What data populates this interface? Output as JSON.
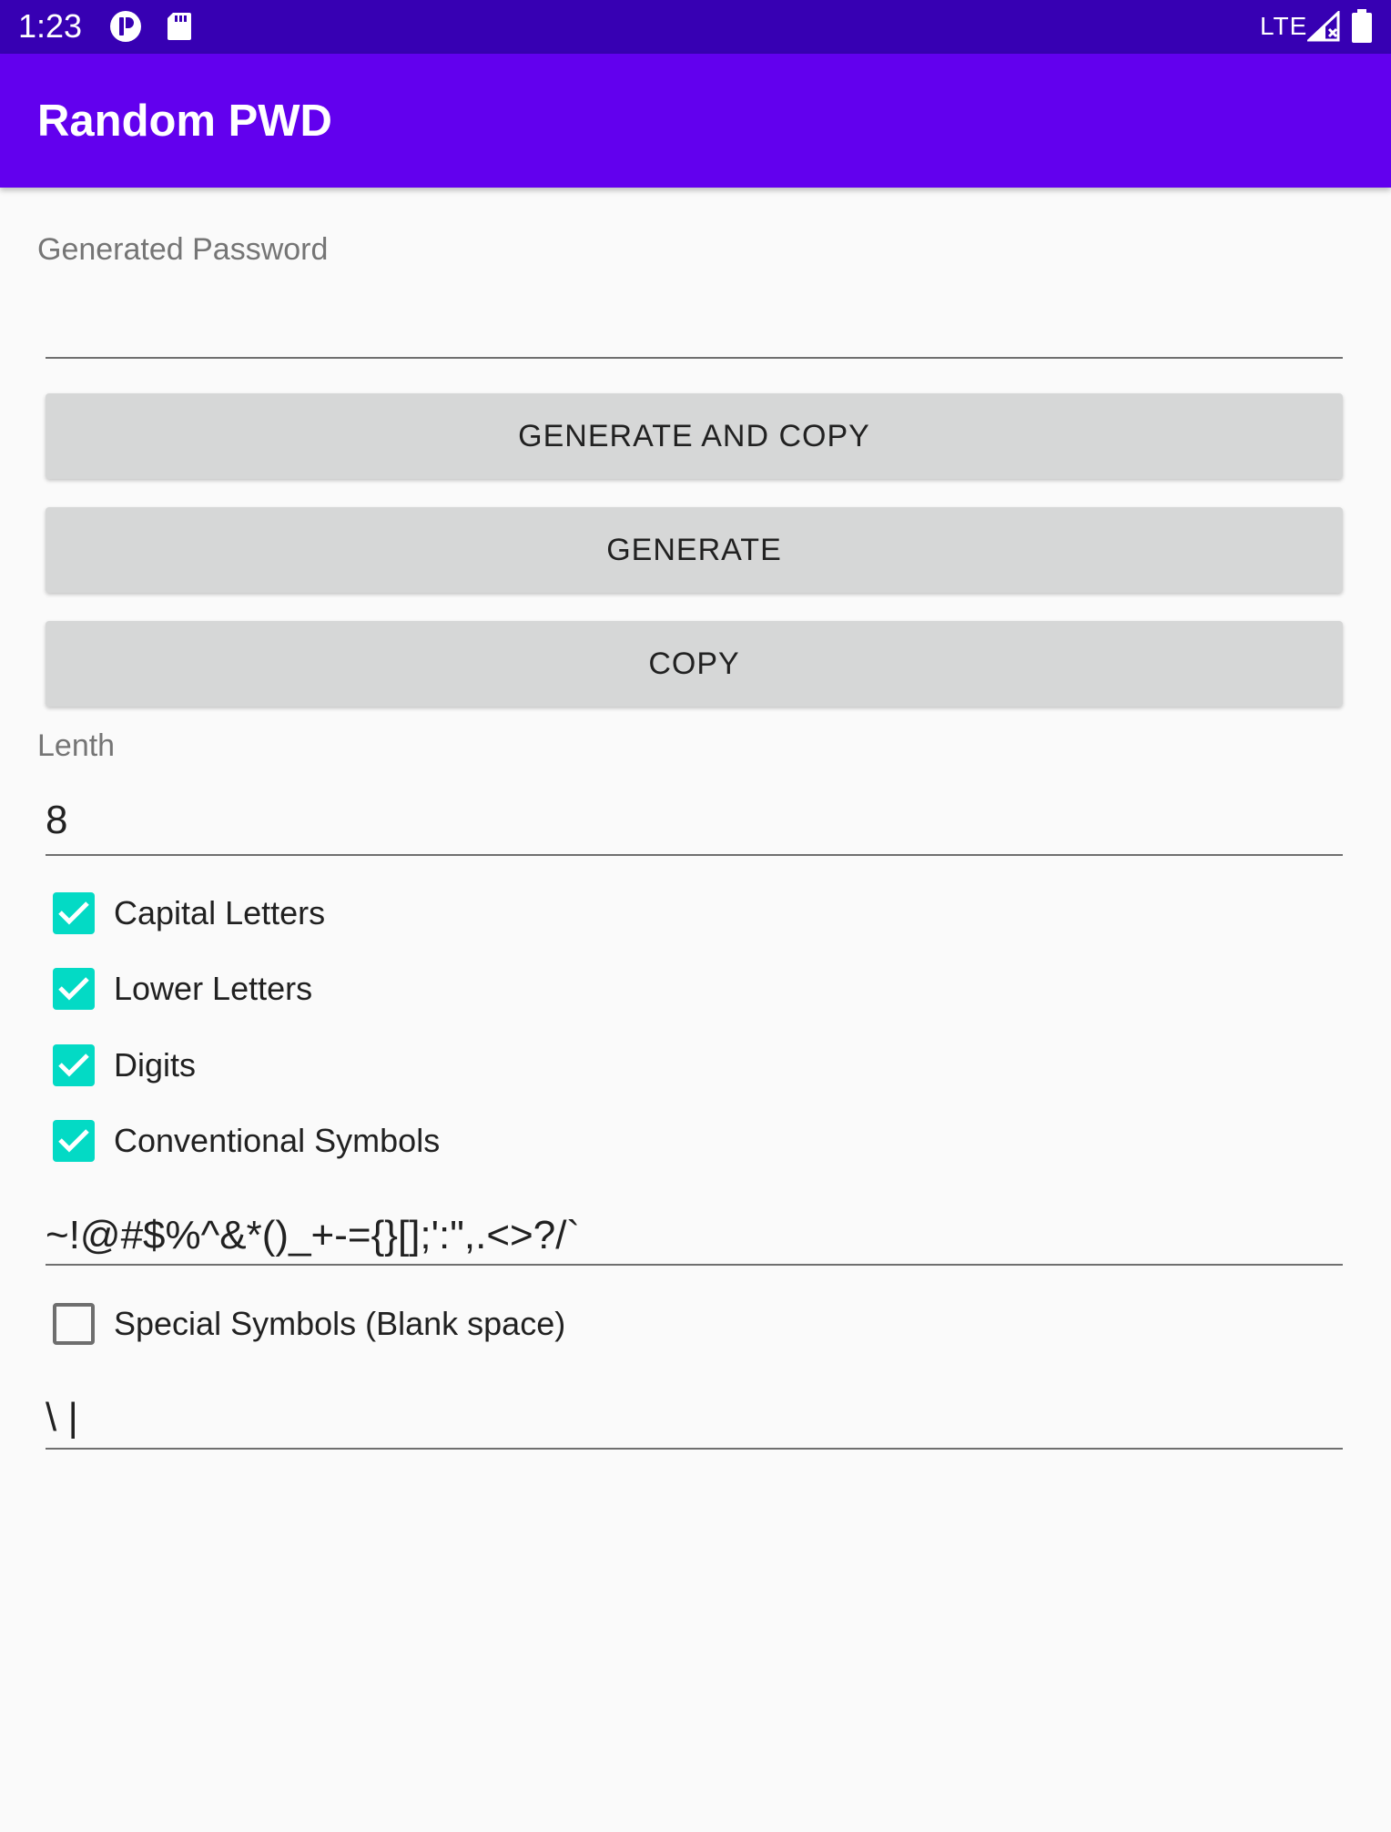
{
  "status_bar": {
    "time": "1:23",
    "network": "LTE",
    "icons": [
      "app-notification-icon",
      "sd-card-icon",
      "signal-icon",
      "battery-icon"
    ]
  },
  "app_bar": {
    "title": "Random PWD",
    "color": "#6200ee"
  },
  "password_field": {
    "label": "Generated Password",
    "value": ""
  },
  "buttons": {
    "generate_and_copy": "GENERATE AND COPY",
    "generate": "GENERATE",
    "copy": "COPY"
  },
  "length_field": {
    "label": "Lenth",
    "value": "8"
  },
  "options": [
    {
      "label": "Capital Letters",
      "checked": true
    },
    {
      "label": "Lower Letters",
      "checked": true
    },
    {
      "label": "Digits",
      "checked": true
    },
    {
      "label": "Conventional Symbols",
      "checked": true
    }
  ],
  "conventional_symbols_field": {
    "value": "~!@#$%^&*()_+-={}[];':\",.<>?/`"
  },
  "special_option": {
    "label": "Special Symbols (Blank space)",
    "checked": false
  },
  "special_symbols_field": {
    "value": "\\ |"
  },
  "colors": {
    "status_bar": "#3700b3",
    "primary": "#6200ee",
    "checkbox_accent": "#03dac5",
    "button_bg": "#d6d7d7"
  }
}
